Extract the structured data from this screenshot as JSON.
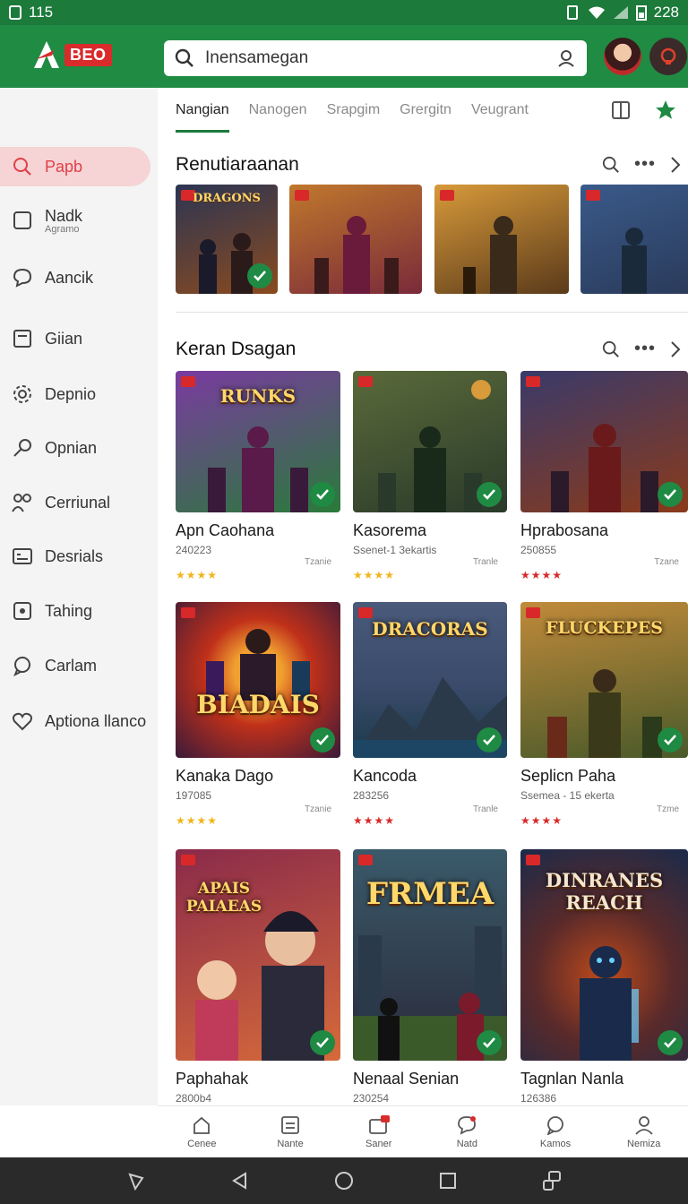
{
  "status": {
    "time": "115",
    "battery": "228"
  },
  "app": {
    "logo_text": "BEO",
    "search_value": "Inensamegan"
  },
  "sidebar": {
    "items": [
      {
        "label": "Papb",
        "icon": "search-icon"
      },
      {
        "label": "Nadk",
        "sub": "Agramo",
        "icon": "square-icon"
      },
      {
        "label": "Aancik",
        "icon": "chat-icon"
      },
      {
        "label": "Giian",
        "icon": "calendar-icon"
      },
      {
        "label": "Depnio",
        "icon": "gear-icon"
      },
      {
        "label": "Opnian",
        "icon": "pin-icon"
      },
      {
        "label": "Cerriunal",
        "icon": "people-icon"
      },
      {
        "label": "Desrials",
        "icon": "card-icon"
      },
      {
        "label": "Tahing",
        "icon": "square-dot-icon"
      },
      {
        "label": "Carlam",
        "icon": "bubble-icon"
      },
      {
        "label": "Aptiona llanco",
        "icon": "heart-icon"
      }
    ]
  },
  "tabs": [
    "Nangian",
    "Nanogen",
    "Srapgim",
    "Grergitn",
    "Veugrant"
  ],
  "section1": {
    "title": "Renutiaraanan",
    "thumbs": [
      {
        "caption": "DRAGONS",
        "palette": [
          "#2b3553",
          "#8a4a1f"
        ]
      },
      {
        "caption": "",
        "palette": [
          "#c0782c",
          "#7a2a3a"
        ]
      },
      {
        "caption": "",
        "palette": [
          "#d89a3a",
          "#5a3a1a"
        ]
      },
      {
        "caption": "",
        "palette": [
          "#3a5a8a",
          "#2a3a5a"
        ]
      }
    ]
  },
  "section2": {
    "title": "Keran Dsagan",
    "cards": [
      {
        "name": "Apn Caohana",
        "meta": "240223",
        "tiny": "Tzanie",
        "stars": "★★★★",
        "star_color": "#f1b51c",
        "art_title": "RUNKS",
        "palette": [
          "#7a3aa0",
          "#2a7a3a"
        ]
      },
      {
        "name": "Kasorema",
        "meta": "Ssenet-1 3ekartis",
        "tiny": "Tranle",
        "stars": "★★★★",
        "star_color": "#f1b51c",
        "art_title": "",
        "palette": [
          "#5a6a3a",
          "#2a3a2a"
        ]
      },
      {
        "name": "Hprabosana",
        "meta": "250855",
        "tiny": "Tzane",
        "stars": "★★★★",
        "star_color": "#d62b2b",
        "art_title": "",
        "palette": [
          "#3a3a6a",
          "#8a3a1a"
        ]
      },
      {
        "name": "Kanaka Dago",
        "meta": "197085",
        "tiny": "Tzanie",
        "stars": "★★★★",
        "star_color": "#f1b51c",
        "art_title": "BIADAIS",
        "palette": [
          "#c0301a",
          "#3a1a3a"
        ]
      },
      {
        "name": "Kancoda",
        "meta": "283256",
        "tiny": "Tranle",
        "stars": "★★★★",
        "star_color": "#d62b2b",
        "art_title": "DRACORAS",
        "palette": [
          "#4a5a7a",
          "#2a3a4a"
        ]
      },
      {
        "name": "Seplicn Paha",
        "meta": "Ssemea - 15 ekerta",
        "tiny": "Tzme",
        "stars": "★★★★",
        "star_color": "#d62b2b",
        "art_title": "FLUCKEPES",
        "palette": [
          "#c08a3a",
          "#4a5a2a"
        ]
      },
      {
        "name": "Paphahak",
        "meta": "2800b4",
        "tiny": "",
        "stars": "",
        "star_color": "#f1b51c",
        "art_title": "APAIS PAIAEAS",
        "palette": [
          "#8a2a4a",
          "#d66a3a"
        ]
      },
      {
        "name": "Nenaal Senian",
        "meta": "230254",
        "tiny": "",
        "stars": "",
        "star_color": "#f1b51c",
        "art_title": "FRMEA",
        "palette": [
          "#3a5a6a",
          "#2a2a3a"
        ]
      },
      {
        "name": "Tagnlan Nanla",
        "meta": "126386",
        "tiny": "",
        "stars": "",
        "star_color": "#f1b51c",
        "art_title": "DINRANES REACH",
        "palette": [
          "#1a2a4a",
          "#c04a1a"
        ]
      }
    ]
  },
  "bottom_nav": [
    {
      "label": "Cenee",
      "icon": "home-icon"
    },
    {
      "label": "Nante",
      "icon": "list-icon"
    },
    {
      "label": "Saner",
      "icon": "bag-icon"
    },
    {
      "label": "Natd",
      "icon": "chat-heart-icon"
    },
    {
      "label": "Kamos",
      "icon": "bubble-icon"
    },
    {
      "label": "Nemiza",
      "icon": "person-icon"
    }
  ],
  "colors": {
    "accent": "#208b43",
    "active_bg": "#f6d3d5",
    "active_text": "#e0404a"
  }
}
